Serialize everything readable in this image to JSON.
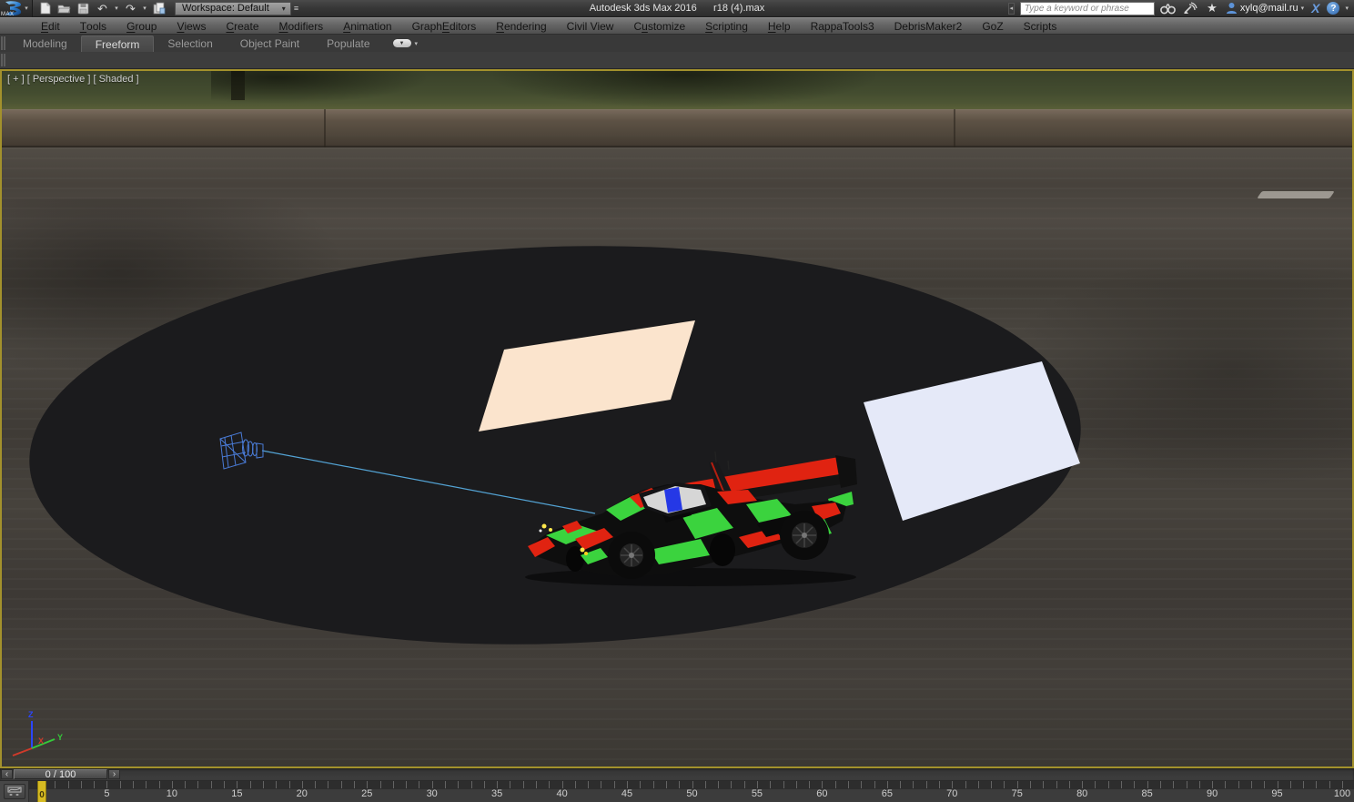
{
  "titlebar": {
    "logo_text": "MAX",
    "workspace_label": "Workspace: Default",
    "title": "Autodesk 3ds Max 2016      r18 (4).max",
    "search_placeholder": "Type a keyword or phrase",
    "account_email": "xylq@mail.ru",
    "exchange_glyph": "X",
    "help_glyph": "?"
  },
  "icons": {
    "undo": "↶",
    "redo": "↷",
    "caret": "▾",
    "star": "★",
    "prev": "‹",
    "next": "›",
    "expander": "◂",
    "pill_arrow": "▼"
  },
  "menubar": {
    "items": [
      {
        "label": "Edit",
        "accel": 0
      },
      {
        "label": "Tools",
        "accel": 0
      },
      {
        "label": "Group",
        "accel": 0
      },
      {
        "label": "Views",
        "accel": 0
      },
      {
        "label": "Create",
        "accel": 0
      },
      {
        "label": "Modifiers",
        "accel": 0
      },
      {
        "label": "Animation",
        "accel": 0
      },
      {
        "label": "Graph Editors",
        "accel": 6
      },
      {
        "label": "Rendering",
        "accel": 0
      },
      {
        "label": "Civil View",
        "accel": -1
      },
      {
        "label": "Customize",
        "accel": 1
      },
      {
        "label": "Scripting",
        "accel": 0
      },
      {
        "label": "Help",
        "accel": 0
      },
      {
        "label": "RappaTools3",
        "accel": -1
      },
      {
        "label": "DebrisMaker2",
        "accel": -1
      },
      {
        "label": "GoZ",
        "accel": -1
      },
      {
        "label": "Scripts",
        "accel": -1
      }
    ]
  },
  "ribbon": {
    "tabs": [
      {
        "label": "Modeling",
        "active": false
      },
      {
        "label": "Freeform",
        "active": true
      },
      {
        "label": "Selection",
        "active": false
      },
      {
        "label": "Object Paint",
        "active": false
      },
      {
        "label": "Populate",
        "active": false
      }
    ]
  },
  "viewport": {
    "label": "[ + ] [ Perspective ] [ Shaded ]",
    "axis": {
      "x": "X",
      "y": "Y",
      "z": "Z"
    }
  },
  "timeline": {
    "current_display": "0 / 100",
    "current_frame": "0",
    "ruler": {
      "min": 0,
      "max": 100,
      "tick_step": 1,
      "label_step": 5
    }
  },
  "colors": {
    "viewport-border": "#a3912c",
    "disc": "#1b1b1d",
    "plane-peach": "#fbe4cd",
    "plane-lavender": "#e5e9f8",
    "camera-blue": "#4a7cd8",
    "target-line": "#5ab2e8",
    "car-green": "#3bd33e",
    "car-red": "#e02311",
    "car-blue": "#2538e6",
    "axis-x": "#d03a2a",
    "axis-y": "#35c93a",
    "axis-z": "#2b46ff",
    "marker-yellow": "#d6bb22"
  }
}
